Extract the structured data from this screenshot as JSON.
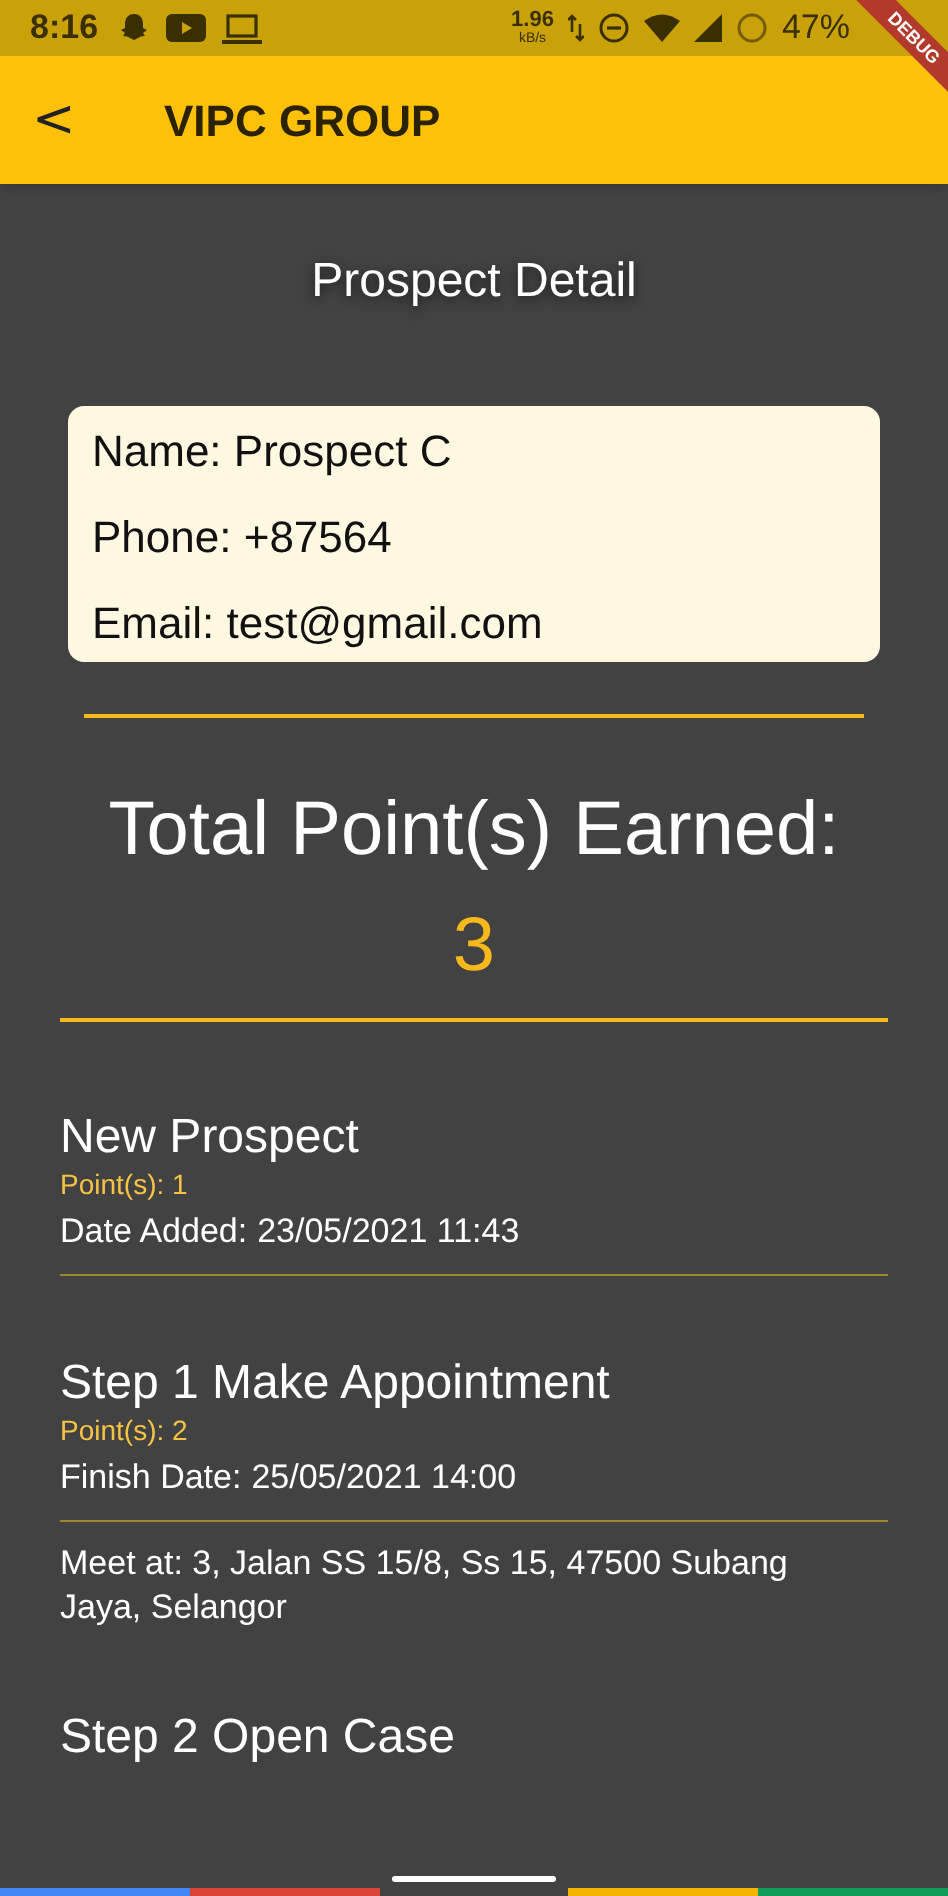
{
  "status_bar": {
    "time": "8:16",
    "speed": "1.96",
    "speed_unit": "kB/s",
    "battery": "47%"
  },
  "debug_banner": "DEBUG",
  "app_bar": {
    "back": "<",
    "title": "VIPC GROUP"
  },
  "page_title": "Prospect Detail",
  "contact": [
    "Name: Prospect C",
    "Phone: +87564",
    "Email: test@gmail.com"
  ],
  "total": {
    "label": "Total Point(s) Earned:",
    "value": "3"
  },
  "steps": [
    {
      "title": "New Prospect",
      "points": "Point(s): 1",
      "date_label": "Date Added:",
      "date": "23/05/2021 11:43"
    },
    {
      "title": "Step 1 Make Appointment",
      "points": "Point(s): 2",
      "date_label": "Finish Date:",
      "date": "25/05/2021 14:00",
      "note": "Meet at: 3, Jalan SS 15/8, Ss 15, 47500 Subang Jaya, Selangor"
    },
    {
      "title": "Step 2 Open Case"
    }
  ]
}
